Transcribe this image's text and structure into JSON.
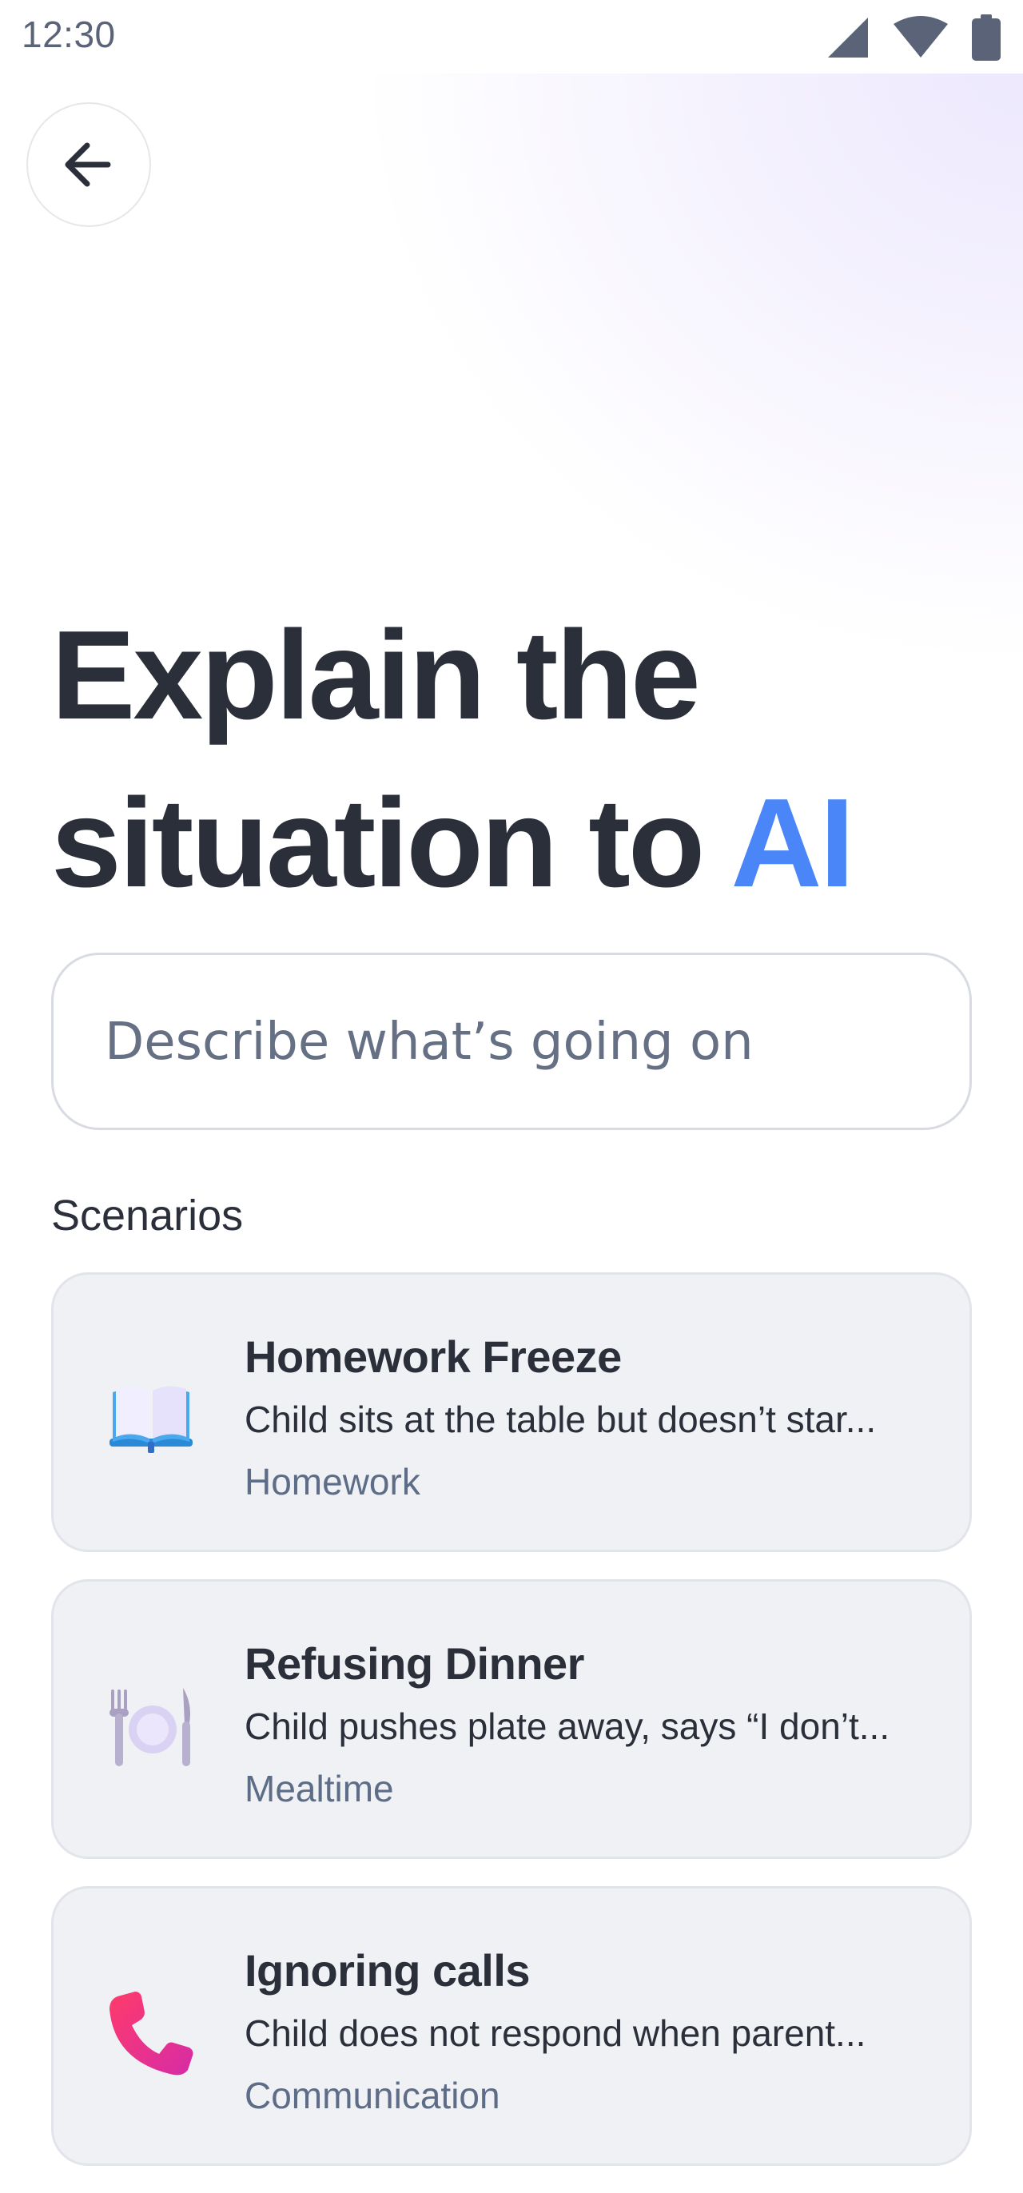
{
  "status_bar": {
    "time": "12:30",
    "icons": [
      "signal-icon",
      "wifi-icon",
      "battery-icon"
    ]
  },
  "header": {
    "back_icon": "arrow-left-icon"
  },
  "title": {
    "line1": "Explain the",
    "line2_prefix": "situation to ",
    "line2_highlight": "AI",
    "highlight_color": "#4a86f7"
  },
  "input": {
    "placeholder": "Describe what’s going on",
    "value": ""
  },
  "scenarios": {
    "label": "Scenarios",
    "items": [
      {
        "icon": "open-book-icon",
        "title": "Homework Freeze",
        "description": "Child sits at the table but doesn’t star...",
        "category": "Homework"
      },
      {
        "icon": "plate-cutlery-icon",
        "title": "Refusing Dinner",
        "description": "Child pushes plate away, says “I don’t...",
        "category": "Mealtime"
      },
      {
        "icon": "telephone-receiver-icon",
        "title": "Ignoring calls",
        "description": "Child does not respond when parent...",
        "category": "Communication"
      }
    ]
  },
  "colors": {
    "text": "#2b2f3a",
    "accent": "#4a86f7",
    "muted": "#5d6c87",
    "card_bg": "#eff1f5"
  }
}
